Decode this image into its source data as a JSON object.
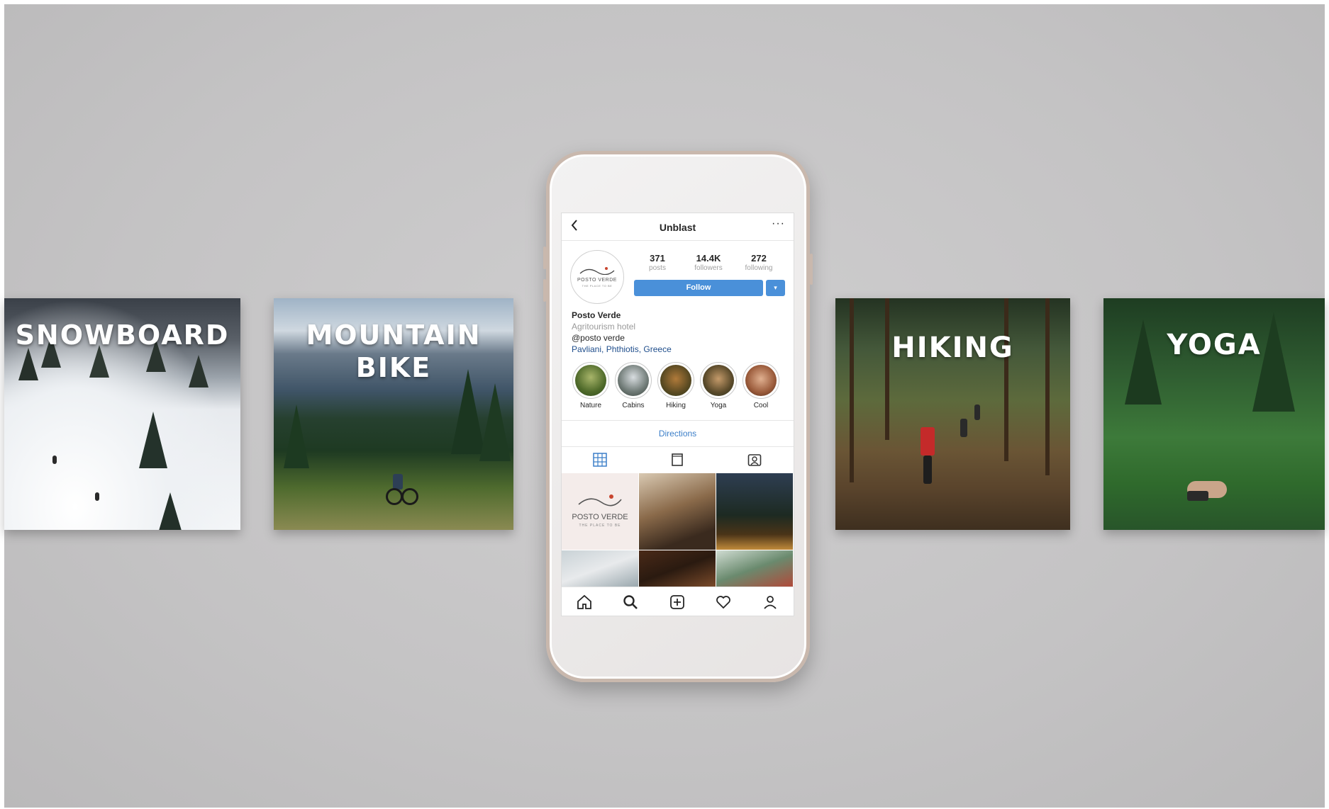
{
  "cards": [
    {
      "id": "snowboard",
      "title": "SNOWBOARD"
    },
    {
      "id": "bike",
      "title_lines": [
        "MOUNTAIN",
        "BIKE"
      ]
    },
    {
      "id": "hiking",
      "title": "HIKING"
    },
    {
      "id": "yoga",
      "title": "YOGA"
    }
  ],
  "phone": {
    "header": {
      "back_icon": "chevron-left-icon",
      "title": "Unblast",
      "more_icon": "more-dots-icon",
      "more_glyph": "···"
    },
    "avatar": {
      "logo_text": "POSTO VERDE",
      "logo_sub": "THE PLACE TO BE"
    },
    "stats": [
      {
        "value": "371",
        "label": "posts"
      },
      {
        "value": "14.4K",
        "label": "followers"
      },
      {
        "value": "272",
        "label": "following"
      }
    ],
    "follow_label": "Follow",
    "follow_dropdown_glyph": "▾",
    "bio": {
      "name": "Posto Verde",
      "category": "Agritourism hotel",
      "handle": "@posto verde",
      "location": "Pavliani, Phthiotis, Greece"
    },
    "highlights": [
      {
        "label": "Nature"
      },
      {
        "label": "Cabins"
      },
      {
        "label": "Hiking"
      },
      {
        "label": "Yoga"
      },
      {
        "label": "Cool"
      }
    ],
    "directions_label": "Directions",
    "tab_icons": [
      "grid-icon",
      "feed-icon",
      "tagged-icon"
    ],
    "grid_first": {
      "logo_text": "POSTO VERDE",
      "logo_sub": "THE PLACE TO BE"
    },
    "nav_icons": [
      "home-icon",
      "search-icon",
      "add-post-icon",
      "heart-icon",
      "profile-icon"
    ]
  },
  "colors": {
    "accent": "#4a90d9",
    "link": "#1f4e8c",
    "directions": "#3b7ec8",
    "logo_red": "#c8452f"
  }
}
